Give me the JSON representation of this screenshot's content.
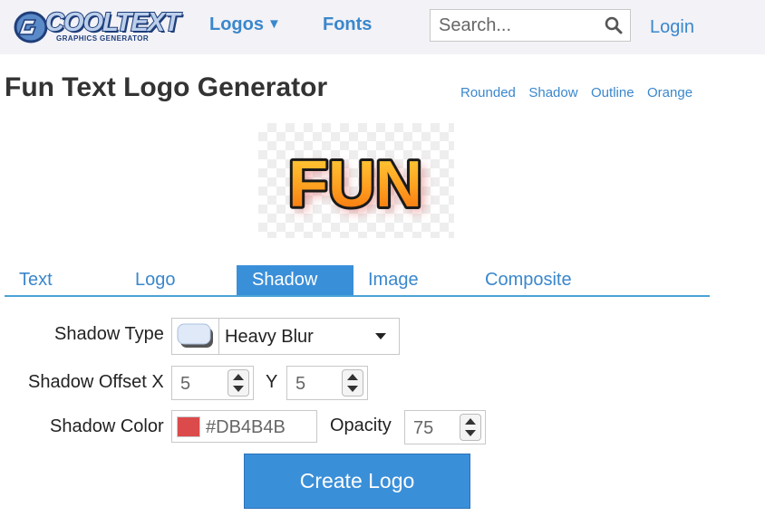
{
  "header": {
    "brand": {
      "name": "COOLTEXT",
      "tagline": "GRAPHICS GENERATOR",
      "colors": {
        "fill": "#bcd0ec",
        "outline": "#1f3e7a"
      }
    },
    "nav": [
      {
        "label": "Logos",
        "dropdown": true,
        "icon": "caret-down-icon"
      },
      {
        "label": "Fonts",
        "dropdown": false
      }
    ],
    "search": {
      "placeholder": "Search...",
      "value": "",
      "icon": "search-icon"
    },
    "login_label": "Login"
  },
  "page": {
    "title": "Fun Text Logo Generator",
    "style_links": [
      "Rounded",
      "Shadow",
      "Outline",
      "Orange"
    ]
  },
  "preview": {
    "text": "FUN",
    "background": "transparent-checkerboard"
  },
  "tabs": [
    {
      "label": "Text",
      "active": false
    },
    {
      "label": "Logo",
      "active": false
    },
    {
      "label": "Shadow",
      "active": true
    },
    {
      "label": "Image",
      "active": false
    },
    {
      "label": "Composite",
      "active": false
    }
  ],
  "form": {
    "shadow_type": {
      "label": "Shadow Type",
      "value": "Heavy Blur"
    },
    "offset": {
      "label_x": "Shadow Offset X",
      "label_y": "Y",
      "x": "5",
      "y": "5"
    },
    "color": {
      "label": "Shadow Color",
      "value": "#DB4B4B"
    },
    "opacity": {
      "label": "Opacity",
      "value": "75"
    }
  },
  "create_button": {
    "label": "Create Logo"
  },
  "colors": {
    "accent": "#3a87cc",
    "tab_active": "#3a8fd9",
    "tab_underline": "#4aa3d6",
    "button": "#3a8fd9",
    "header_bg": "#f2f2f7"
  }
}
